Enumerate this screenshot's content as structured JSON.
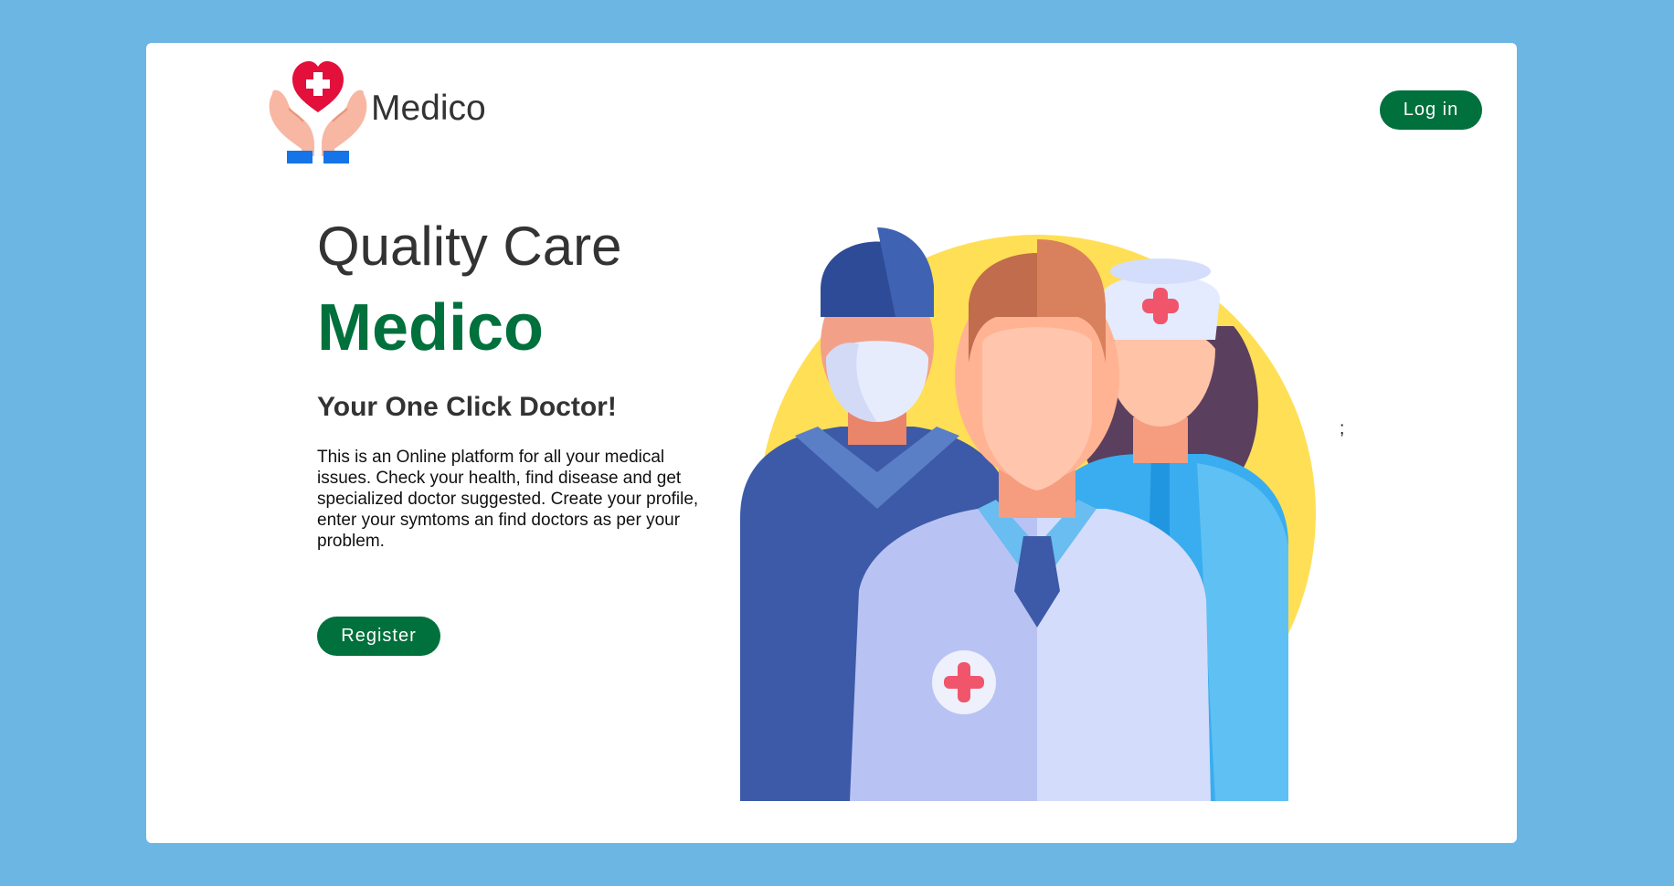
{
  "header": {
    "brand": "Medico",
    "login_label": "Log in",
    "logo_icon": "heart-in-hands-icon"
  },
  "hero": {
    "title": "Quality Care",
    "brand": "Medico",
    "tagline": "Your One Click Doctor!",
    "description": "This is an Online platform for all your medical issues. Check your health, find disease and get specialized doctor suggested. Create your profile, enter your symtoms an find doctors as per your problem.",
    "register_label": "Register",
    "stray_text": ";"
  },
  "illustration": {
    "icon": "medical-team-illustration"
  },
  "colors": {
    "background": "#6bb6e3",
    "accent": "#00703c",
    "text": "#333333"
  }
}
